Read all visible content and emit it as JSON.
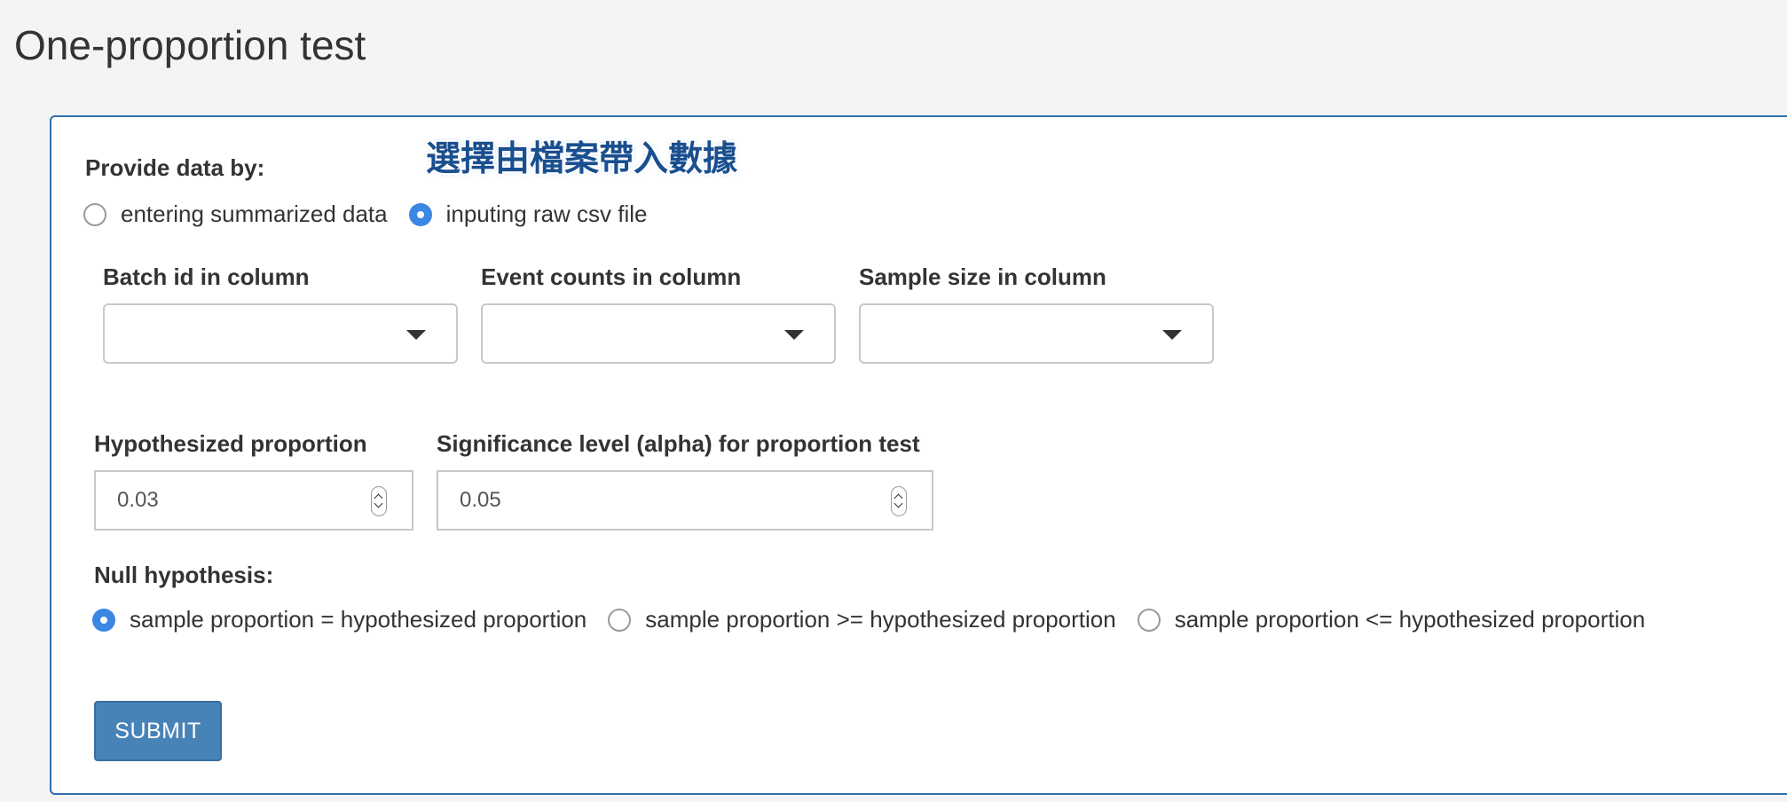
{
  "page": {
    "title": "One-proportion test"
  },
  "annotation": {
    "text": "選擇由檔案帶入數據",
    "color": "#1a4f8f"
  },
  "provide_data": {
    "label": "Provide data by:",
    "options": [
      {
        "label": "entering summarized data",
        "checked": false
      },
      {
        "label": "inputing raw csv file",
        "checked": true
      }
    ]
  },
  "columns": {
    "batch_id": {
      "label": "Batch id in column",
      "value": ""
    },
    "event_counts": {
      "label": "Event counts in column",
      "value": ""
    },
    "sample_size": {
      "label": "Sample size in column",
      "value": ""
    }
  },
  "hypothesized_proportion": {
    "label": "Hypothesized proportion",
    "value": "0.03"
  },
  "significance_level": {
    "label": "Significance level (alpha) for proportion test",
    "value": "0.05"
  },
  "null_hypothesis": {
    "label": "Null hypothesis:",
    "options": [
      {
        "label": "sample proportion = hypothesized proportion",
        "checked": true
      },
      {
        "label": "sample proportion >= hypothesized proportion",
        "checked": false
      },
      {
        "label": "sample proportion <= hypothesized proportion",
        "checked": false
      }
    ]
  },
  "submit": {
    "label": "SUBMIT"
  },
  "colors": {
    "accent": "#3b87e4",
    "panel_border": "#2f6fb0",
    "button": "#4883b8",
    "background": "#f4f4f4"
  }
}
